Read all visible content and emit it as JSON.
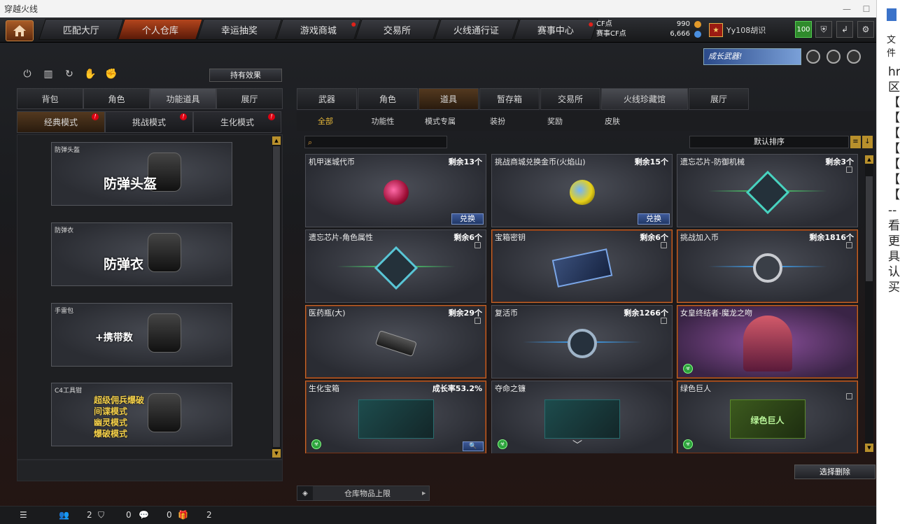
{
  "window": {
    "title": "穿越火线"
  },
  "nav": {
    "tabs": [
      {
        "label": "匹配大厅",
        "dot": false
      },
      {
        "label": "个人仓库",
        "dot": false,
        "active": true
      },
      {
        "label": "幸运抽奖",
        "dot": false
      },
      {
        "label": "游戏商城",
        "dot": true
      },
      {
        "label": "交易所",
        "dot": false
      },
      {
        "label": "火线通行证",
        "dot": false
      },
      {
        "label": "赛事中心",
        "dot": true
      }
    ],
    "cf_label": "CF点",
    "cf_value": "990",
    "event_cf_label": "赛事CF点",
    "event_cf_value": "6,666",
    "username": "Yy108胡识",
    "level": "100"
  },
  "banner": {
    "text": "成长武器!"
  },
  "left": {
    "effect_button": "持有效果",
    "tabs": [
      "背包",
      "角色",
      "功能道具",
      "展厅"
    ],
    "modes": [
      "经典模式",
      "挑战模式",
      "生化模式"
    ],
    "cards": [
      {
        "label": "防弹头盔",
        "big": "防弹头盔"
      },
      {
        "label": "防弹衣",
        "big": "防弹衣"
      },
      {
        "label": "手雷包",
        "big": "+携带数"
      },
      {
        "label": "C4工具钳",
        "lines": [
          "超级佣兵爆破",
          "间谍模式",
          "幽灵模式",
          "爆破模式"
        ]
      }
    ]
  },
  "right": {
    "tabs": [
      "武器",
      "角色",
      "道具",
      "暂存箱",
      "交易所",
      "火线珍藏馆",
      "展厅"
    ],
    "subtabs": [
      "全部",
      "功能性",
      "模式专属",
      "装扮",
      "奖励",
      "皮肤"
    ],
    "sort_label": "默认排序",
    "items": [
      {
        "name": "机甲迷城代币",
        "count": "剩余13个",
        "action": "兑换"
      },
      {
        "name": "挑战商城兑换金币(火焰山)",
        "count": "剩余15个",
        "action": "兑换"
      },
      {
        "name": "遗忘芯片-防御机械",
        "count": "剩余3个"
      },
      {
        "name": "遗忘芯片-角色属性",
        "count": "剩余6个"
      },
      {
        "name": "宝箱密钥",
        "count": "剩余6个"
      },
      {
        "name": "挑战加入币",
        "count": "剩余1816个"
      },
      {
        "name": "医药瓶(大)",
        "count": "剩余29个"
      },
      {
        "name": "复活币",
        "count": "剩余1266个"
      },
      {
        "name": "女皇终结者-魔龙之吻",
        "count": ""
      },
      {
        "name": "生化宝箱",
        "count": "成长率53.2%"
      },
      {
        "name": "夺命之镰",
        "count": ""
      },
      {
        "name": "绿色巨人",
        "count": "",
        "overlay": "绿色巨人"
      }
    ],
    "select_delete": "选择删除",
    "storage_limit": "仓库物品上限"
  },
  "statusbar": {
    "c1": "2",
    "c2": "0",
    "c3": "0",
    "c4": "2"
  },
  "sidepanel": {
    "file": "文件",
    "lines": [
      "hr",
      "区",
      "【",
      "【",
      "【",
      "【",
      "【",
      "【",
      "【",
      "--",
      "看",
      "更",
      "具",
      "认",
      "买"
    ]
  },
  "colors": {
    "accent": "#b3451d",
    "gold": "#e7b93a",
    "highlight_border": "#c4672c"
  }
}
